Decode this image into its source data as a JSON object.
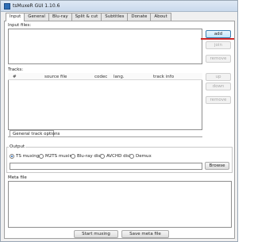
{
  "window": {
    "title": "tsMuxeR GUI 1.10.6"
  },
  "tabs": [
    "Input",
    "General",
    "Blu-ray",
    "Split & cut",
    "Subtitles",
    "Donate",
    "About"
  ],
  "input": {
    "label": "Input files:",
    "buttons": {
      "add": "add",
      "join": "join",
      "remove": "remove"
    }
  },
  "tracks": {
    "label": "Tracks:",
    "columns": [
      "#",
      "source file",
      "codec",
      "lang.",
      "track info"
    ],
    "buttons": {
      "up": "up",
      "down": "down",
      "remove": "remove"
    },
    "options_tab": "General track options"
  },
  "output": {
    "label": "Output",
    "options": [
      "TS muxing",
      "M2TS muxing",
      "Blu-ray disk",
      "AVCHD disk",
      "Demux"
    ],
    "selected": "TS muxing",
    "browse": "Browse"
  },
  "meta": {
    "label": "Meta file"
  },
  "footer": {
    "start": "Start muxing",
    "save": "Save meta file"
  },
  "colors": {
    "accent_mark": "#d02a2a",
    "selected_button": "#3c7fb1"
  }
}
